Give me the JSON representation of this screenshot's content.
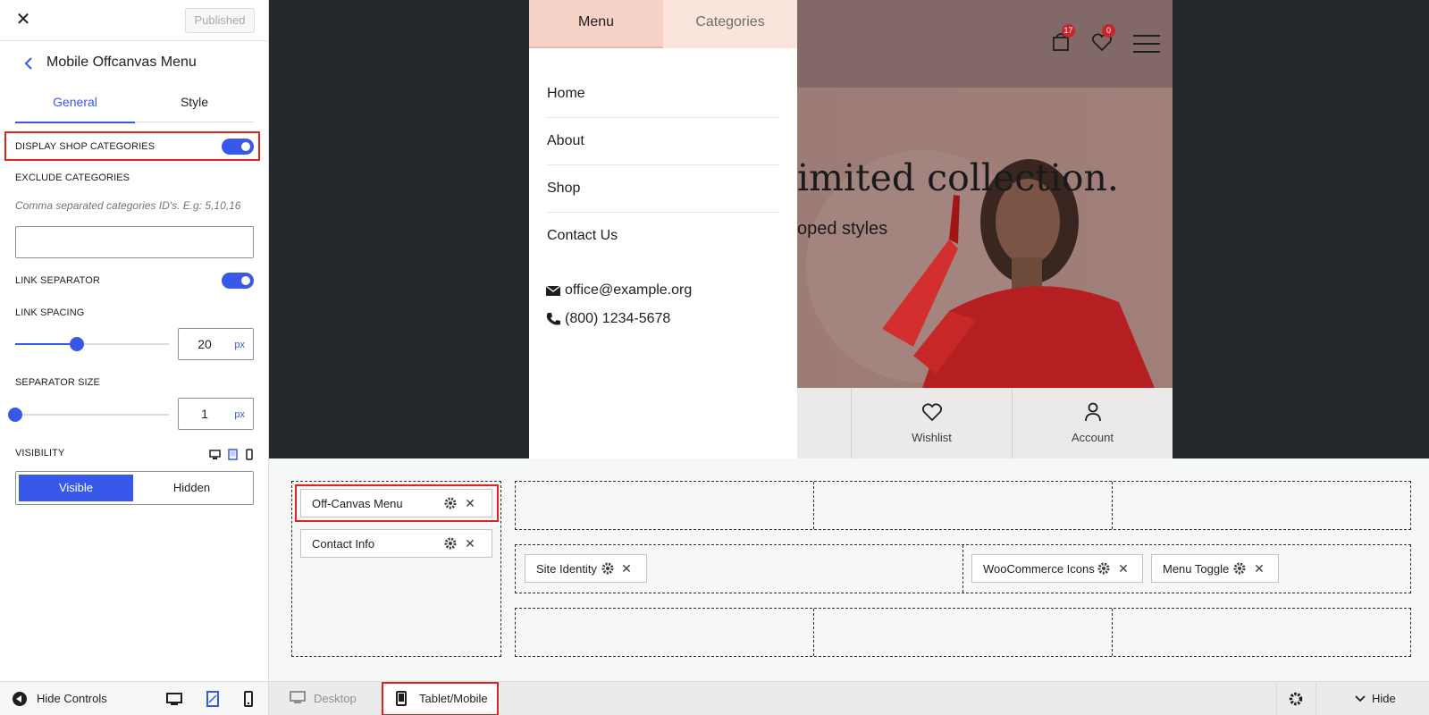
{
  "sidebar": {
    "status_button": "Published",
    "section_title": "Mobile Offcanvas Menu",
    "tabs": [
      {
        "label": "General",
        "active": true
      },
      {
        "label": "Style",
        "active": false
      }
    ],
    "display_shop_categories": {
      "label": "DISPLAY SHOP CATEGORIES",
      "enabled": true
    },
    "exclude_categories": {
      "label": "EXCLUDE CATEGORIES",
      "hint": "Comma separated categories ID's. E.g: 5,10,16",
      "value": ""
    },
    "link_separator": {
      "label": "LINK SEPARATOR",
      "enabled": true
    },
    "link_spacing": {
      "label": "LINK SPACING",
      "value": "20",
      "unit": "px",
      "fraction": 0.4
    },
    "separator_size": {
      "label": "SEPARATOR SIZE",
      "value": "1",
      "unit": "px",
      "fraction": 0.0
    },
    "visibility": {
      "label": "VISIBILITY",
      "options": [
        "Visible",
        "Hidden"
      ],
      "selected": "Visible"
    },
    "hide_controls": "Hide Controls"
  },
  "preview": {
    "header": {
      "cart_count": "17",
      "wishlist_count": "0"
    },
    "hero": {
      "heading": "imited collection.",
      "subheading": "oped styles"
    },
    "bottom_nav": [
      "Wishlist",
      "Account"
    ],
    "offcanvas": {
      "tabs": [
        "Menu",
        "Categories"
      ],
      "active_tab": "Menu",
      "menu_items": [
        "Home",
        "About",
        "Shop",
        "Contact Us"
      ],
      "email": "office@example.org",
      "phone": "(800) 1234-5678"
    }
  },
  "builder": {
    "left_items": [
      "Off-Canvas Menu",
      "Contact Info"
    ],
    "main_items": [
      "Site Identity"
    ],
    "right_items": [
      "WooCommerce Icons",
      "Menu Toggle"
    ]
  },
  "bottom_bar": {
    "devices": [
      "Desktop",
      "Tablet/Mobile"
    ],
    "active_device": "Tablet/Mobile",
    "hide_label": "Hide"
  },
  "colors": {
    "accent": "#3858e9",
    "highlight": "#e0241b",
    "badge": "#c8252c"
  }
}
